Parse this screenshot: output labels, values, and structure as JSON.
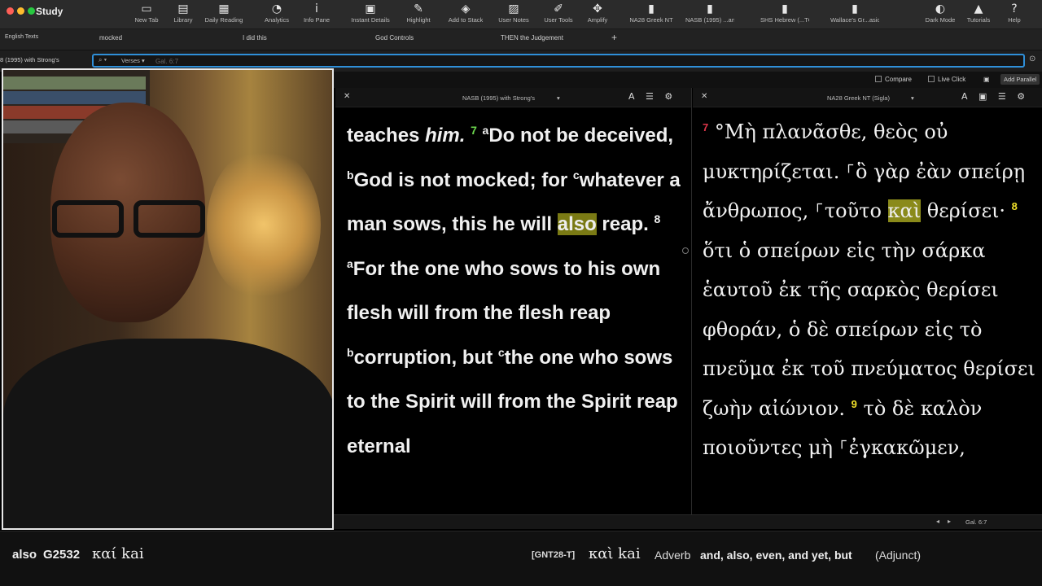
{
  "app": {
    "title": "Study"
  },
  "colors": {
    "accent": "#2f8fd8",
    "highlight": "#7a7a14",
    "verse_green": "#6cd64e",
    "verse_red": "#e0364a",
    "verse_yellow": "#f0e02a"
  },
  "toolbar": {
    "items": [
      {
        "label": "New Tab",
        "icon": "new-tab-icon",
        "glyph": "▭"
      },
      {
        "label": "Library",
        "icon": "library-icon",
        "glyph": "▤"
      },
      {
        "label": "Daily Reading",
        "icon": "calendar-icon",
        "glyph": "▦"
      },
      {
        "label": "Analytics",
        "icon": "analytics-icon",
        "glyph": "◔"
      },
      {
        "label": "Info Pane",
        "icon": "info-icon",
        "glyph": "i"
      },
      {
        "label": "Instant Details",
        "icon": "instant-details-icon",
        "glyph": "▣"
      },
      {
        "label": "Highlight",
        "icon": "highlighter-icon",
        "glyph": "✎"
      },
      {
        "label": "Add to Stack",
        "icon": "stack-icon",
        "glyph": "◈"
      },
      {
        "label": "User Notes",
        "icon": "notes-icon",
        "glyph": "▨"
      },
      {
        "label": "User Tools",
        "icon": "pen-icon",
        "glyph": "✐"
      },
      {
        "label": "Amplify",
        "icon": "amplify-icon",
        "glyph": "✥"
      },
      {
        "label": "NA28 Greek NT",
        "icon": "book-na28-icon",
        "glyph": "▮"
      },
      {
        "label": "NASB (1995) ...ang's",
        "icon": "book-nasb-icon",
        "glyph": "▮"
      },
      {
        "label": "SHS Hebrew (...TCBC)",
        "icon": "book-hebrew-icon",
        "glyph": "▮"
      },
      {
        "label": "Wallace's Gr...asics",
        "icon": "book-wallace-icon",
        "glyph": "▮"
      },
      {
        "label": "Dark Mode",
        "icon": "bulb-icon",
        "glyph": "◐"
      },
      {
        "label": "Tutorials",
        "icon": "graduation-cap-icon",
        "glyph": "▲"
      },
      {
        "label": "Help",
        "icon": "help-icon",
        "glyph": "?"
      }
    ]
  },
  "tabs": [
    {
      "label": "English Texts"
    },
    {
      "label": "mocked"
    },
    {
      "label": "I did this"
    },
    {
      "label": "God Controls"
    },
    {
      "label": "THEN the Judgement"
    }
  ],
  "search": {
    "left_resource": "8 (1995) with Strong's",
    "mode": "Verses",
    "placeholder": "Gal. 6:7"
  },
  "options": {
    "compare": "Compare",
    "live_click": "Live Click",
    "add_parallel": "Add Parallel"
  },
  "left_panel": {
    "title": "NASB (1995) with Strong's",
    "text": {
      "p1": "teaches ",
      "p1_em": "him.",
      "v7": "7",
      "ma": "a",
      "p2": "Do not be deceived, ",
      "mb": "b",
      "p3": "God is not mocked; for ",
      "mc": "c",
      "p4": "whatever a man sows, this he will ",
      "hl": "also",
      "p5": " reap. ",
      "v8": "8",
      "ma2": "a",
      "p6": "For the one who sows to his own flesh will from the flesh reap ",
      "mb2": "b",
      "p7": "corruption, but ",
      "mc2": "c",
      "p8": "the one who sows to the Spirit will from the Spirit reap eternal"
    }
  },
  "right_panel": {
    "title": "NA28 Greek NT (Sigla)",
    "text": {
      "v7": "7",
      "g1": " °Μὴ πλανᾶσθε, θεὸς οὐ μυκτηρίζεται. ⸀ὃ γὰρ ἐὰν σπείρῃ ἄνθρωπος, ⸀τοῦτο ",
      "hl": "καὶ",
      "g2": " θερίσει· ",
      "v8": "8",
      "g3": " ὅτι ὁ σπείρων εἰς τὴν σάρκα ἑαυτοῦ ἐκ τῆς σαρκὸς θερίσει φθοράν, ὁ δὲ σπείρων εἰς τὸ πνεῦμα ἐκ τοῦ πνεύματος θερίσει ζωὴν αἰώνιον. ",
      "v9": "9",
      "g4": " τὸ δὲ καλὸν ποιοῦντες μὴ ⸀ἐγκακῶμεν,"
    }
  },
  "status": {
    "reference": "Gal. 6:7"
  },
  "info_bar": {
    "word": "also",
    "strongs": "G2532",
    "greek": "καί kai",
    "source": "[GNT28-T]",
    "lemma": "καὶ kai",
    "pos": "Adverb",
    "gloss": "and, also, even, and yet, but",
    "role": "(Adjunct)"
  }
}
